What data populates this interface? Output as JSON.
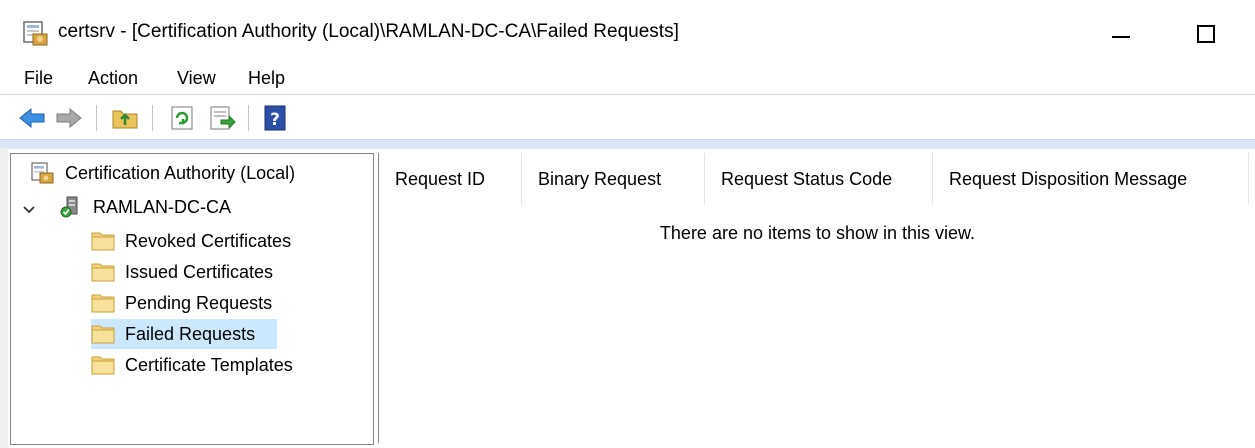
{
  "window": {
    "title": "certsrv - [Certification Authority (Local)\\RAMLAN-DC-CA\\Failed Requests]",
    "icon": "certsrv-app-icon"
  },
  "menu": {
    "items": [
      {
        "label": "File"
      },
      {
        "label": "Action"
      },
      {
        "label": "View"
      },
      {
        "label": "Help"
      }
    ]
  },
  "toolbar": {
    "buttons": [
      {
        "icon": "back-arrow-icon"
      },
      {
        "icon": "forward-arrow-icon"
      },
      {
        "icon": "up-folder-icon"
      },
      {
        "icon": "refresh-icon"
      },
      {
        "icon": "export-list-icon"
      },
      {
        "icon": "help-icon"
      }
    ]
  },
  "tree": {
    "root": {
      "label": "Certification Authority (Local)",
      "icon": "certsrv-app-icon"
    },
    "ca": {
      "label": "RAMLAN-DC-CA",
      "expanded": true,
      "icon": "ca-server-icon"
    },
    "children": [
      {
        "label": "Revoked Certificates",
        "icon": "folder-icon"
      },
      {
        "label": "Issued Certificates",
        "icon": "folder-icon"
      },
      {
        "label": "Pending Requests",
        "icon": "folder-icon"
      },
      {
        "label": "Failed Requests",
        "icon": "folder-icon",
        "selected": true
      },
      {
        "label": "Certificate Templates",
        "icon": "folder-icon"
      }
    ]
  },
  "list": {
    "columns": [
      {
        "label": "Request ID"
      },
      {
        "label": "Binary Request"
      },
      {
        "label": "Request Status Code"
      },
      {
        "label": "Request Disposition Message"
      }
    ],
    "empty_message": "There are no items to show in this view."
  },
  "colors": {
    "selection": "#cce8ff",
    "accent_bar": "#dbe7f5",
    "pane_border": "#828790"
  }
}
